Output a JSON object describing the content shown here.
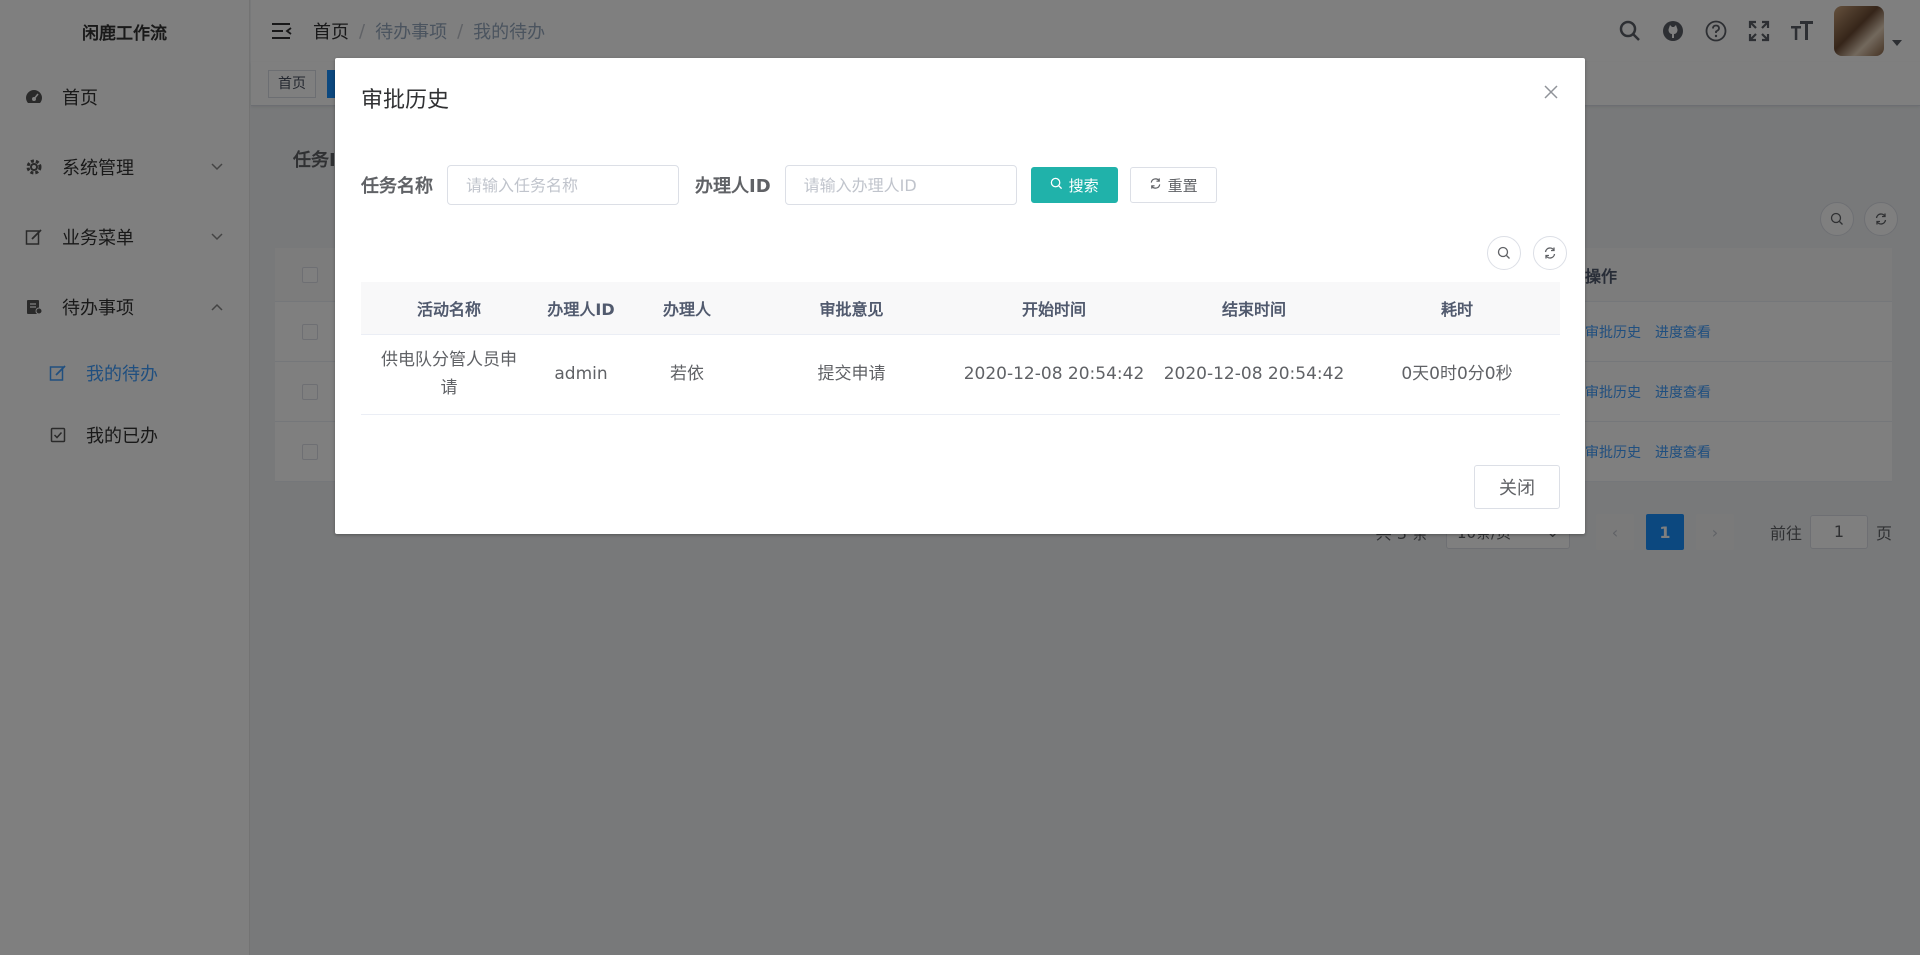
{
  "app": {
    "title": "闲鹿工作流"
  },
  "sidebar": {
    "items": [
      {
        "label": "首页",
        "icon": "dashboard-icon"
      },
      {
        "label": "系统管理",
        "icon": "gear-icon"
      },
      {
        "label": "业务菜单",
        "icon": "edit-icon"
      },
      {
        "label": "待办事项",
        "icon": "todo-icon"
      }
    ],
    "subitems": [
      {
        "label": "我的待办",
        "icon": "edit-icon"
      },
      {
        "label": "我的已办",
        "icon": "checkbox-icon"
      }
    ]
  },
  "header": {
    "breadcrumb": [
      "首页",
      "待办事项",
      "我的待办"
    ],
    "separator": "/"
  },
  "tags": {
    "home": "首页"
  },
  "main": {
    "filter_label": "任务I",
    "table": {
      "op_header": "操作",
      "action_history": "审批历史",
      "action_progress": "进度查看",
      "rows": 3
    },
    "pager": {
      "total": "共 3 条",
      "page_size": "10条/页",
      "current": "1",
      "goto_label": "前往",
      "goto_value": "1",
      "page_suffix": "页"
    }
  },
  "dialog": {
    "title": "审批历史",
    "form": {
      "task_name_label": "任务名称",
      "task_name_placeholder": "请输入任务名称",
      "assignee_label": "办理人ID",
      "assignee_placeholder": "请输入办理人ID",
      "search_label": "搜索",
      "reset_label": "重置"
    },
    "table": {
      "columns": [
        "活动名称",
        "办理人ID",
        "办理人",
        "审批意见",
        "开始时间",
        "结束时间",
        "耗时"
      ],
      "rows": [
        [
          "供电队分管人员申请",
          "admin",
          "若依",
          "提交申请",
          "2020-12-08 20:54:42",
          "2020-12-08 20:54:42",
          "0天0时0分0秒"
        ]
      ]
    },
    "close_label": "关闭"
  },
  "colors": {
    "primary": "#1890ff",
    "teal": "#20b2aa",
    "active_menu": "#409eff"
  }
}
